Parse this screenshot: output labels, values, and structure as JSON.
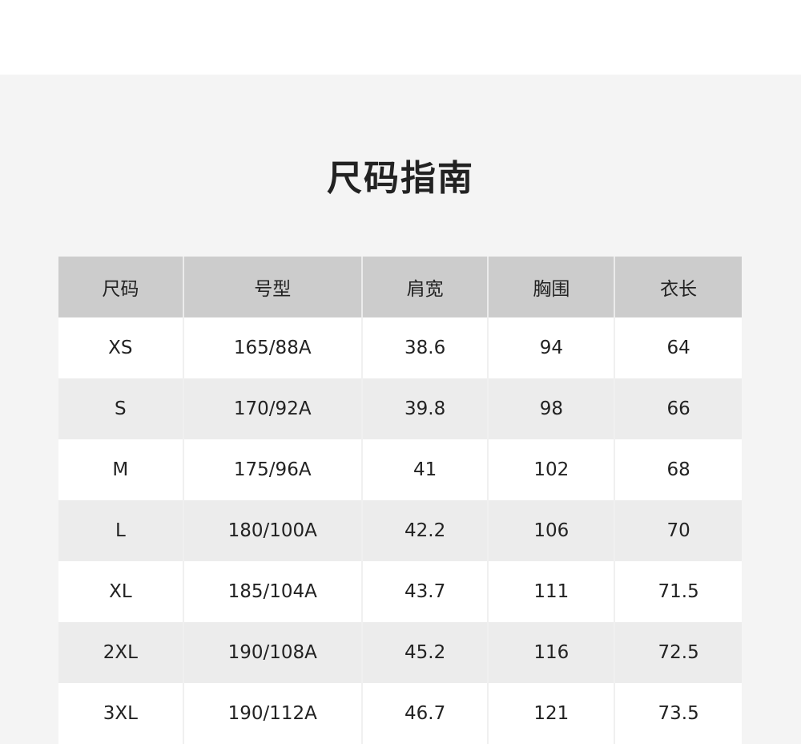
{
  "title": "尺码指南",
  "table": {
    "headers": [
      "尺码",
      "号型",
      "肩宽",
      "胸围",
      "衣长"
    ],
    "rows": [
      [
        "XS",
        "165/88A",
        "38.6",
        "94",
        "64"
      ],
      [
        "S",
        "170/92A",
        "39.8",
        "98",
        "66"
      ],
      [
        "M",
        "175/96A",
        "41",
        "102",
        "68"
      ],
      [
        "L",
        "180/100A",
        "42.2",
        "106",
        "70"
      ],
      [
        "XL",
        "185/104A",
        "43.7",
        "111",
        "71.5"
      ],
      [
        "2XL",
        "190/108A",
        "45.2",
        "116",
        "72.5"
      ],
      [
        "3XL",
        "190/112A",
        "46.7",
        "121",
        "73.5"
      ]
    ]
  },
  "colors": {
    "panel_bg": "#f4f4f4",
    "header_bg": "#cccccc",
    "row_alt_bg": "#ececec",
    "text": "#222222"
  }
}
